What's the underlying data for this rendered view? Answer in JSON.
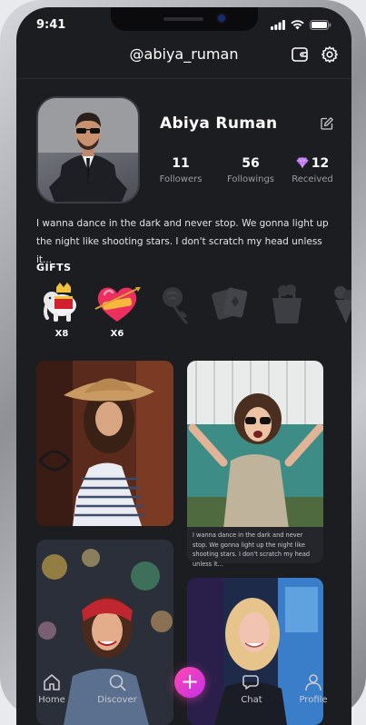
{
  "status_bar": {
    "time": "9:41"
  },
  "header": {
    "username": "@abiya_ruman"
  },
  "profile": {
    "name": "Abiya Ruman",
    "stats": [
      {
        "value": "11",
        "label": "Followers"
      },
      {
        "value": "56",
        "label": "Followings"
      },
      {
        "value": "12",
        "label": "Received"
      }
    ],
    "bio_line1": "I wanna dance in the dark and never stop. We gonna light up",
    "bio_line2": "the night like shooting stars. I don't scratch my head unless it..."
  },
  "gifts": {
    "title": "GIFTS",
    "items": [
      {
        "icon": "elephant-gift-icon",
        "count": "X8"
      },
      {
        "icon": "heart-gift-icon",
        "count": "X6"
      },
      {
        "icon": "rose-gift-icon",
        "count": ""
      },
      {
        "icon": "cards-gift-icon",
        "count": ""
      },
      {
        "icon": "bag-gift-icon",
        "count": ""
      },
      {
        "icon": "bouquet-gift-icon",
        "count": ""
      }
    ]
  },
  "feed": {
    "caption": "I wanna dance in the dark and never stop. We gonna light up the night like shooting stars. I don't scratch my head unless it..."
  },
  "tabbar": {
    "items": [
      {
        "label": "Home",
        "icon": "home-icon"
      },
      {
        "label": "Discover",
        "icon": "search-icon"
      },
      {
        "label": "Chat",
        "icon": "chat-icon"
      },
      {
        "label": "Profile",
        "icon": "profile-icon"
      }
    ],
    "add_icon": "plus-icon"
  },
  "colors": {
    "background": "#1c1d21",
    "accent": "#ff49b0",
    "muted_text": "#9a9ca3",
    "gem": "#b86cf0"
  }
}
